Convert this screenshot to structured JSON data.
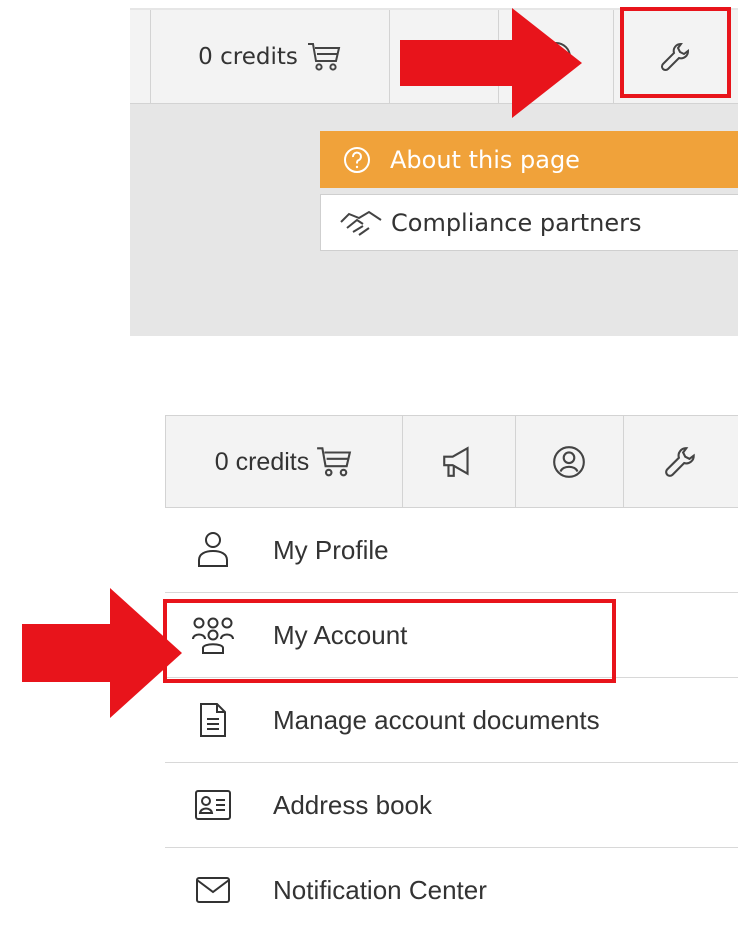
{
  "panel_top": {
    "toolbar": {
      "credits_label": "0 credits",
      "buttons": [
        "cart-icon",
        "megaphone-icon",
        "user-circle-icon",
        "wrench-icon"
      ]
    },
    "menu": {
      "about": "About this page",
      "partners": "Compliance partners"
    }
  },
  "panel_bottom": {
    "toolbar": {
      "credits_label": "0 credits",
      "buttons": [
        "cart-icon",
        "megaphone-icon",
        "user-circle-icon",
        "wrench-icon"
      ]
    },
    "menu": [
      {
        "label": "My Profile",
        "icon": "user-icon"
      },
      {
        "label": "My Account",
        "icon": "users-icon"
      },
      {
        "label": "Manage account documents",
        "icon": "document-icon"
      },
      {
        "label": "Address book",
        "icon": "contact-card-icon"
      },
      {
        "label": "Notification Center",
        "icon": "envelope-icon"
      }
    ]
  },
  "colors": {
    "highlight": "#e8141b",
    "menu_active": "#f0a23a",
    "toolbar_bg": "#f3f3f3"
  }
}
